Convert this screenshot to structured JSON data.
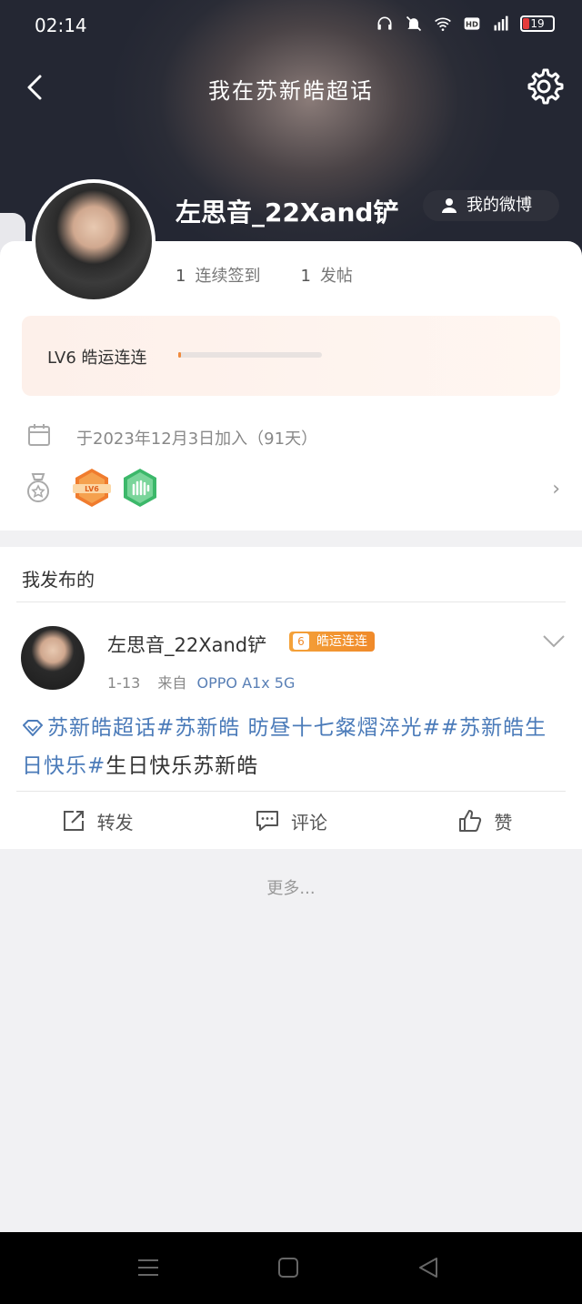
{
  "status_bar": {
    "time": "02:14",
    "battery": "19",
    "icons": [
      "headphones-icon",
      "mute-icon",
      "wifi-icon",
      "hd-icon",
      "signal-icon",
      "battery-icon"
    ]
  },
  "header": {
    "title": "我在苏新皓超话",
    "back_icon": "chevron-left-icon",
    "settings_icon": "gear-icon",
    "side_tab_glyph": "⟩"
  },
  "profile": {
    "username": "左思音_22Xand铲",
    "my_weibo_label": "我的微博",
    "stats": [
      {
        "value": "1",
        "label": "连续签到"
      },
      {
        "value": "1",
        "label": "发帖"
      }
    ],
    "level_label": "LV6 皓运连连",
    "level_progress": 0.02,
    "join_text": "于2023年12月3日加入（91天）",
    "badges": [
      "lv6-badge",
      "hand-badge"
    ],
    "badge_lv_text": "LV6"
  },
  "posts": {
    "header": "我发布的",
    "items": [
      {
        "author": "左思音_22Xand铲",
        "fan_level": "6",
        "fan_title": "皓运连连",
        "date": "1-13",
        "source_prefix": "来自",
        "device": "OPPO A1x 5G",
        "text_tag1": "苏新皓超话",
        "text_tag2": "#苏新皓 昉昼十七粲熠淬光#",
        "text_tag3": "#苏新皓生日快乐#",
        "text_plain": "生日快乐苏新皓"
      }
    ],
    "actions": {
      "repost": "转发",
      "comment": "评论",
      "like": "赞"
    }
  },
  "more_label": "更多...",
  "colors": {
    "accent": "#f08a3c",
    "link": "#4b7bb9",
    "header_bg": "#242733"
  }
}
